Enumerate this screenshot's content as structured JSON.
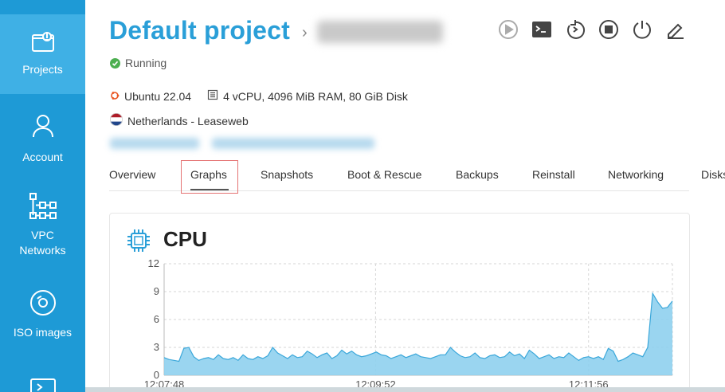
{
  "sidebar": {
    "items": [
      {
        "label": "Projects",
        "icon": "projects-icon",
        "active": true
      },
      {
        "label": "Account",
        "icon": "account-icon",
        "active": false
      },
      {
        "label": "VPC Networks",
        "label_line1": "VPC",
        "label_line2": "Networks",
        "icon": "network-icon",
        "active": false
      },
      {
        "label": "ISO images",
        "icon": "disc-icon",
        "active": false
      }
    ]
  },
  "header": {
    "title": "Default project",
    "separator": "›",
    "status": "Running"
  },
  "server": {
    "os": "Ubuntu 22.04",
    "specs": "4 vCPU, 4096 MiB RAM, 80 GiB Disk",
    "location": "Netherlands - Leaseweb"
  },
  "tabs": [
    {
      "label": "Overview"
    },
    {
      "label": "Graphs",
      "active": true
    },
    {
      "label": "Snapshots"
    },
    {
      "label": "Boot & Rescue"
    },
    {
      "label": "Backups"
    },
    {
      "label": "Reinstall"
    },
    {
      "label": "Networking"
    },
    {
      "label": "Disks"
    }
  ],
  "toolbar": [
    "play-icon",
    "console-icon",
    "reboot-icon",
    "stop-icon",
    "power-icon",
    "edit-icon"
  ],
  "cpu_card": {
    "title": "CPU"
  },
  "colors": {
    "accent": "#2a9fd8",
    "sidebar": "#1e9ad6",
    "sidebar_active": "#3fb0e5",
    "chart_fill": "#8fd0ee",
    "chart_line": "#3aa7da",
    "status": "#4caf50"
  },
  "chart_data": {
    "type": "area",
    "title": "CPU",
    "yticks": [
      0,
      3,
      6,
      9,
      12
    ],
    "ylim": [
      0,
      12
    ],
    "xticks": [
      "12:07:48",
      "12:09:52",
      "12:11:56"
    ],
    "grid": true,
    "values": [
      1.9,
      1.7,
      1.6,
      1.5,
      2.9,
      3.0,
      2.0,
      1.6,
      1.8,
      1.9,
      1.7,
      2.2,
      1.8,
      1.7,
      1.9,
      1.6,
      2.2,
      1.8,
      1.7,
      2.0,
      1.8,
      2.1,
      3.0,
      2.4,
      2.1,
      1.8,
      2.2,
      1.9,
      2.0,
      2.6,
      2.3,
      1.9,
      2.2,
      2.4,
      1.8,
      2.1,
      2.7,
      2.3,
      2.6,
      2.2,
      2.0,
      2.1,
      2.3,
      2.5,
      2.2,
      2.1,
      1.8,
      2.0,
      2.2,
      1.9,
      2.1,
      2.3,
      2.0,
      1.9,
      1.8,
      2.0,
      2.2,
      2.2,
      3.0,
      2.5,
      2.1,
      1.9,
      2.0,
      2.4,
      1.9,
      1.8,
      2.1,
      2.2,
      1.9,
      2.0,
      2.5,
      2.1,
      2.3,
      1.8,
      2.7,
      2.3,
      1.8,
      2.0,
      2.2,
      1.8,
      2.0,
      1.9,
      2.4,
      2.0,
      1.6,
      1.9,
      2.0,
      1.8,
      2.0,
      1.7,
      2.9,
      2.6,
      1.5,
      1.7,
      2.0,
      2.4,
      2.2,
      2.0,
      3.0,
      8.8,
      7.9,
      7.2,
      7.3,
      8.0
    ]
  }
}
